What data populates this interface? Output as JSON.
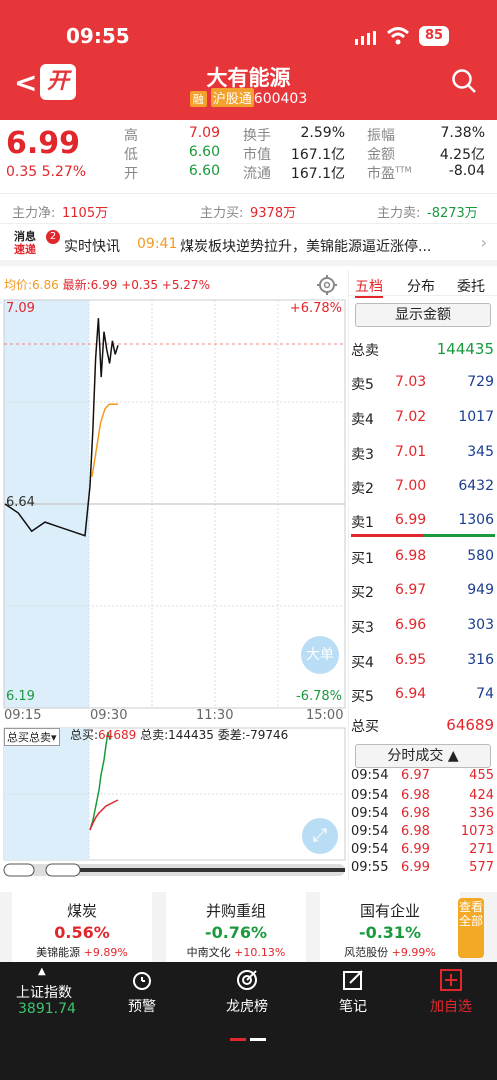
{
  "status": {
    "time": "09:55",
    "battery": "85"
  },
  "header": {
    "open_badge": "开",
    "name": "大有能源",
    "margin_tag": "融",
    "connect_tag": "沪股通",
    "code": "600403"
  },
  "quote": {
    "price": "6.99",
    "change": "0.35",
    "change_pct": "5.27%",
    "stats": [
      {
        "label": "高",
        "value": "7.09",
        "color": "red"
      },
      {
        "label": "低",
        "value": "6.60",
        "color": "green"
      },
      {
        "label": "开",
        "value": "6.60",
        "color": "green"
      },
      {
        "label": "换手",
        "value": "2.59%"
      },
      {
        "label": "市值",
        "value": "167.1亿"
      },
      {
        "label": "流通",
        "value": "167.1亿"
      },
      {
        "label": "振幅",
        "value": "7.38%"
      },
      {
        "label": "金额",
        "value": "4.25亿"
      },
      {
        "label": "市盈",
        "value": "-8.04"
      }
    ],
    "ttm": "TTM"
  },
  "flow": {
    "net_label": "主力净:",
    "net": "1105万",
    "buy_label": "主力买:",
    "buy": "9378万",
    "sell_label": "主力卖:",
    "sell": "-8273万"
  },
  "news": {
    "logo_top": "消息",
    "logo_bottom": "速递",
    "badge": "2",
    "title": "实时快讯",
    "time": "09:41",
    "text": "煤炭板块逆势拉升，美锦能源逼近涨停..."
  },
  "chart": {
    "avg_label": "均价:6.86",
    "latest_label": "最新:6.99",
    "latest_chg": "+0.35",
    "latest_pct": "+5.27%",
    "y_top": "7.09",
    "y_mid": "6.64",
    "y_bot": "6.19",
    "pct_top": "+6.78%",
    "pct_bot": "-6.78%",
    "times": [
      "09:15",
      "09:30",
      "11:30",
      "15:00"
    ],
    "big_order": "大单",
    "sub_selector": "总买总卖",
    "sub_buy_label": "总买:",
    "sub_buy": "64689",
    "sub_sell_label": "总卖:",
    "sub_sell": "144435",
    "sub_diff_label": "委差:",
    "sub_diff": "-79746"
  },
  "chart_data": {
    "type": "line",
    "title": "",
    "ylim": [
      6.19,
      7.09
    ],
    "series": [
      {
        "name": "最新",
        "values": [
          6.64,
          6.62,
          6.58,
          6.6,
          6.59,
          6.58,
          6.57,
          6.68,
          6.8,
          6.96,
          7.05,
          6.92,
          7.02,
          6.98,
          6.95,
          7.0,
          6.97,
          6.99
        ]
      },
      {
        "name": "均价",
        "values": [
          6.7,
          6.76,
          6.82,
          6.85,
          6.86,
          6.86,
          6.86
        ]
      }
    ]
  },
  "orderbook": {
    "tabs": [
      "五档",
      "分布",
      "委托"
    ],
    "show_amount": "显示金额",
    "total_sell_label": "总卖",
    "total_sell": "144435",
    "asks": [
      {
        "label": "卖5",
        "price": "7.03",
        "vol": "729"
      },
      {
        "label": "卖4",
        "price": "7.02",
        "vol": "1017"
      },
      {
        "label": "卖3",
        "price": "7.01",
        "vol": "345"
      },
      {
        "label": "卖2",
        "price": "7.00",
        "vol": "6432"
      },
      {
        "label": "卖1",
        "price": "6.99",
        "vol": "1306"
      }
    ],
    "bids": [
      {
        "label": "买1",
        "price": "6.98",
        "vol": "580"
      },
      {
        "label": "买2",
        "price": "6.97",
        "vol": "949"
      },
      {
        "label": "买3",
        "price": "6.96",
        "vol": "303"
      },
      {
        "label": "买4",
        "price": "6.95",
        "vol": "316"
      },
      {
        "label": "买5",
        "price": "6.94",
        "vol": "74"
      }
    ],
    "total_buy_label": "总买",
    "total_buy": "64689",
    "ticks_btn": "分时成交",
    "ticks": [
      {
        "t": "09:54",
        "p": "6.97",
        "v": "455"
      },
      {
        "t": "09:54",
        "p": "6.98",
        "v": "424"
      },
      {
        "t": "09:54",
        "p": "6.98",
        "v": "336"
      },
      {
        "t": "09:54",
        "p": "6.98",
        "v": "1073"
      },
      {
        "t": "09:54",
        "p": "6.99",
        "v": "271"
      },
      {
        "t": "09:55",
        "p": "6.99",
        "v": "577"
      }
    ]
  },
  "sectors": [
    {
      "name": "煤炭",
      "pct": "0.56%",
      "color": "red",
      "lead": "美锦能源",
      "lead_pct": "+9.89%"
    },
    {
      "name": "并购重组",
      "pct": "-0.76%",
      "color": "green",
      "lead": "中南文化",
      "lead_pct": "+10.13%"
    },
    {
      "name": "国有企业",
      "pct": "-0.31%",
      "color": "green",
      "lead": "风范股份",
      "lead_pct": "+9.99%"
    }
  ],
  "view_all": "查看全部",
  "nav": {
    "index_name": "上证指数",
    "index_val": "3891.74",
    "items": [
      "预警",
      "龙虎榜",
      "笔记",
      "加自选"
    ]
  }
}
